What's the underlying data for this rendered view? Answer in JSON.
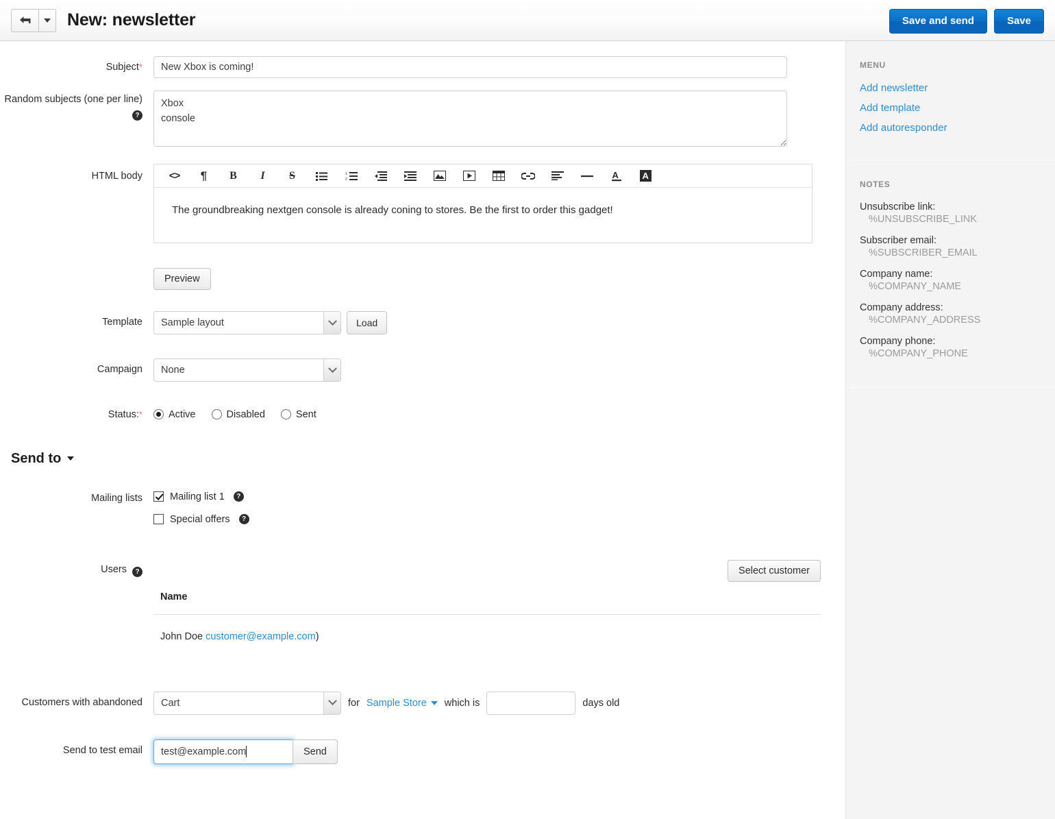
{
  "header": {
    "back_icon": "back-arrow-icon",
    "caret_icon": "chevron-down-icon",
    "title": "New: newsletter",
    "save_and_send_label": "Save and send",
    "save_label": "Save",
    "accent_color": "#0c6fc4"
  },
  "form": {
    "subject": {
      "label": "Subject",
      "required_mark": "*",
      "value": "New Xbox is coming!"
    },
    "random_subjects": {
      "label": "Random subjects (one per line)",
      "help_icon": "?",
      "value": "Xbox\nconsole"
    },
    "html_body": {
      "label": "HTML body",
      "content": "The groundbreaking nextgen console is already coning to stores. Be the first to order this gadget!",
      "toolbar": [
        {
          "name": "source-code-icon",
          "glyph": "<>"
        },
        {
          "name": "paragraph-icon",
          "glyph": "¶"
        },
        {
          "name": "bold-icon",
          "glyph": "B"
        },
        {
          "name": "italic-icon",
          "glyph": "I"
        },
        {
          "name": "strikethrough-icon",
          "glyph": "S"
        },
        {
          "name": "unordered-list-icon",
          "glyph": "list"
        },
        {
          "name": "ordered-list-icon",
          "glyph": "numlist"
        },
        {
          "name": "outdent-icon",
          "glyph": "outdent"
        },
        {
          "name": "indent-icon",
          "glyph": "indent"
        },
        {
          "name": "image-icon",
          "glyph": "image"
        },
        {
          "name": "video-icon",
          "glyph": "video"
        },
        {
          "name": "table-icon",
          "glyph": "table"
        },
        {
          "name": "link-icon",
          "glyph": "link"
        },
        {
          "name": "align-left-icon",
          "glyph": "align"
        },
        {
          "name": "horizontal-rule-icon",
          "glyph": "hr"
        },
        {
          "name": "font-color-icon",
          "glyph": "A"
        },
        {
          "name": "background-color-icon",
          "glyph": "A"
        }
      ]
    },
    "preview_label": "Preview",
    "template": {
      "label": "Template",
      "value": "Sample layout",
      "options": [
        "Sample layout"
      ],
      "load_label": "Load"
    },
    "campaign": {
      "label": "Campaign",
      "value": "None",
      "options": [
        "None"
      ]
    },
    "status": {
      "label": "Status:",
      "required_mark": "*",
      "options": [
        {
          "label": "Active",
          "selected": true
        },
        {
          "label": "Disabled",
          "selected": false
        },
        {
          "label": "Sent",
          "selected": false
        }
      ]
    }
  },
  "send_to": {
    "heading": "Send to",
    "caret_icon": "chevron-down-icon",
    "mailing_lists": {
      "label": "Mailing lists",
      "items": [
        {
          "label": "Mailing list 1",
          "checked": true,
          "help_icon": "?"
        },
        {
          "label": "Special offers",
          "checked": false,
          "help_icon": "?"
        }
      ]
    },
    "users": {
      "label": "Users",
      "help_icon": "?",
      "select_customer_label": "Select customer",
      "columns": [
        "Name"
      ],
      "rows": [
        {
          "name": "John Doe ",
          "email": "customer@example.com",
          "suffix": ")"
        }
      ]
    },
    "abandoned": {
      "label": "Customers with abandoned",
      "select_value": "Cart",
      "select_options": [
        "Cart"
      ],
      "for_label": "for",
      "store_label": "Sample Store",
      "store_caret_icon": "chevron-down-icon",
      "which_is_label": "which is",
      "days_value": "",
      "days_label": "days old"
    },
    "test_email": {
      "label": "Send to test email",
      "value": "test@example.com",
      "send_label": "Send"
    }
  },
  "sidebar": {
    "menu": {
      "heading": "MENU",
      "links": [
        {
          "label": "Add newsletter"
        },
        {
          "label": "Add template"
        },
        {
          "label": "Add autoresponder"
        }
      ]
    },
    "notes": {
      "heading": "NOTES",
      "items": [
        {
          "label": "Unsubscribe link:",
          "value": "%UNSUBSCRIBE_LINK"
        },
        {
          "label": "Subscriber email:",
          "value": "%SUBSCRIBER_EMAIL"
        },
        {
          "label": "Company name:",
          "value": "%COMPANY_NAME"
        },
        {
          "label": "Company address:",
          "value": "%COMPANY_ADDRESS"
        },
        {
          "label": "Company phone:",
          "value": "%COMPANY_PHONE"
        }
      ]
    }
  }
}
